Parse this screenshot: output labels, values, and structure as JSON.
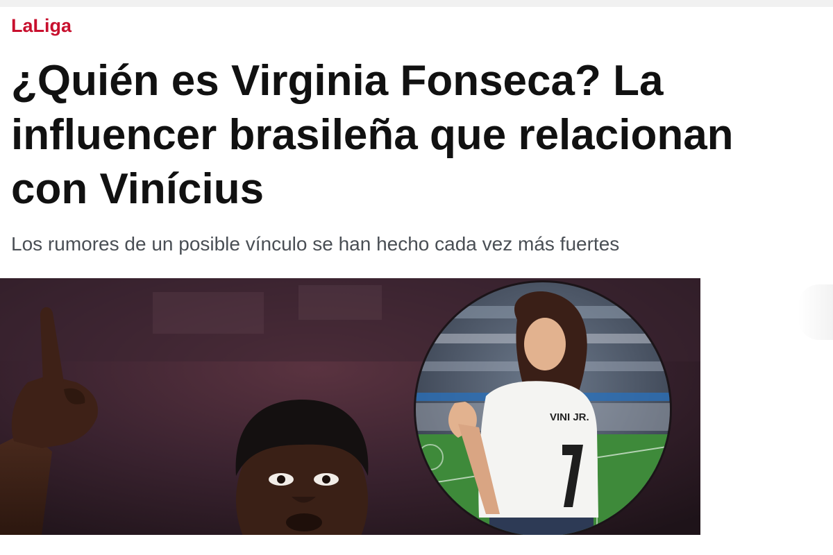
{
  "section": {
    "label": "LaLiga"
  },
  "article": {
    "headline_lines": [
      "¿Quién es Virginia Fonseca? La",
      "influencer brasileña que relacionan",
      "con Vinícius"
    ],
    "subtitle": "Los rumores de un posible vínculo se han hecho cada vez más fuertes"
  },
  "image": {
    "shirt_text": "VINI JR.",
    "shirt_number": "7"
  }
}
